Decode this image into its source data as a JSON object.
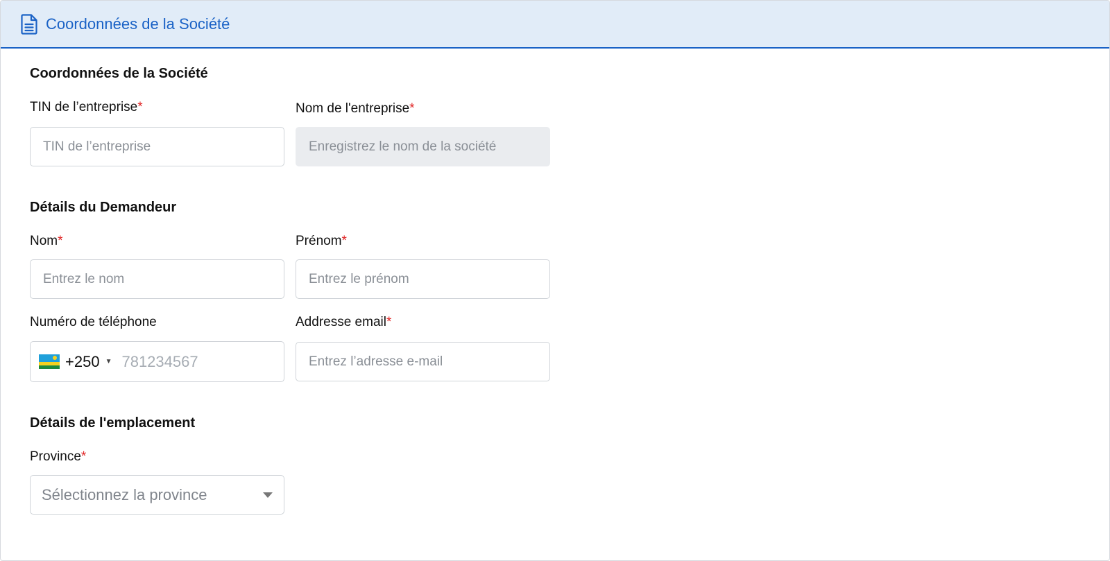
{
  "header": {
    "title": "Coordonnées de la Société",
    "icon": "document-icon"
  },
  "company_section": {
    "title": "Coordonnées de la Société",
    "tin": {
      "label": "TIN de l’entreprise",
      "required_mark": "*",
      "placeholder": "TIN de l’entreprise",
      "value": ""
    },
    "company_name": {
      "label": "Nom de l'entreprise",
      "required_mark": "*",
      "placeholder": "Enregistrez le nom de la société",
      "value": ""
    }
  },
  "applicant_section": {
    "title": "Détails du Demandeur",
    "last_name": {
      "label": "Nom",
      "required_mark": "*",
      "placeholder": "Entrez le nom",
      "value": ""
    },
    "first_name": {
      "label": "Prénom",
      "required_mark": "*",
      "placeholder": "Entrez le prénom",
      "value": ""
    },
    "phone": {
      "label": "Numéro de téléphone",
      "dial_code": "+250",
      "flag": "rwanda-flag-icon",
      "placeholder": "781234567",
      "value": ""
    },
    "email": {
      "label": "Addresse email",
      "required_mark": "*",
      "placeholder": "Entrez l’adresse e-mail",
      "value": ""
    }
  },
  "location_section": {
    "title": "Détails de l'emplacement",
    "province": {
      "label": "Province",
      "required_mark": "*",
      "selected": "Sélectionnez la province"
    }
  },
  "colors": {
    "accent": "#1a62c6",
    "header_bg": "#e1ecf8",
    "required": "#e02424",
    "disabled_bg": "#eaecef"
  }
}
